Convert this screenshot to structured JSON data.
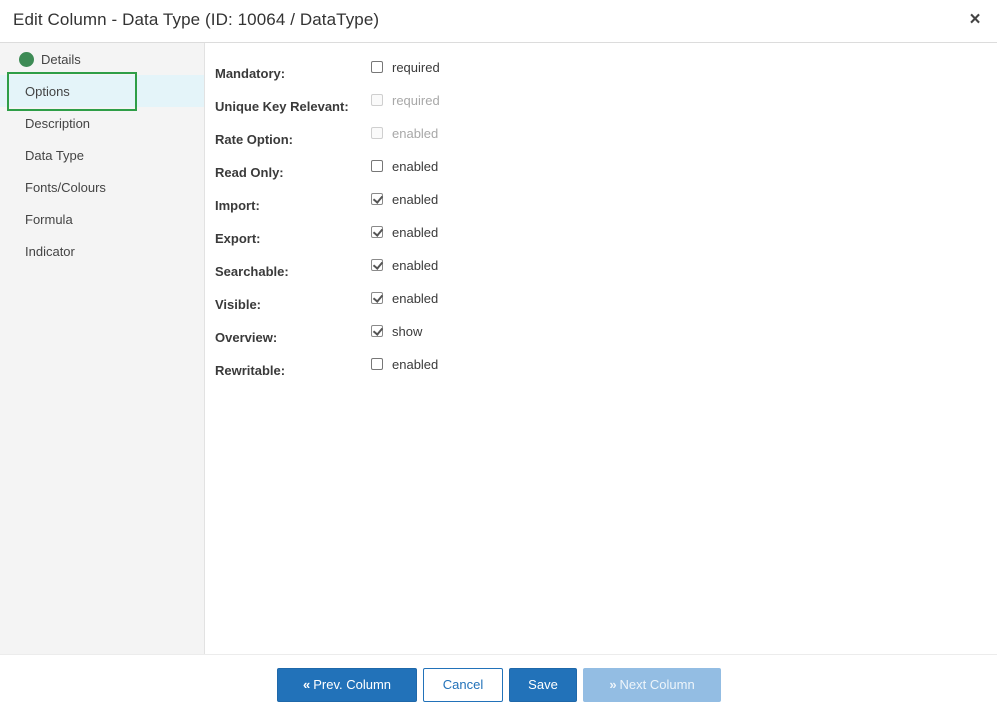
{
  "dialog": {
    "title": "Edit Column - Data Type (ID: 10064 / DataType)",
    "close_icon": "×"
  },
  "sidebar": {
    "items": [
      {
        "label": "Details",
        "status": "complete",
        "status_color": "#3d8b55"
      },
      {
        "label": "Options",
        "active": true
      },
      {
        "label": "Description"
      },
      {
        "label": "Data Type"
      },
      {
        "label": "Fonts/Colours"
      },
      {
        "label": "Formula"
      },
      {
        "label": "Indicator"
      }
    ]
  },
  "options": {
    "rows": [
      {
        "label": "Mandatory:",
        "checkbox_label": "required",
        "checked": false,
        "disabled": false
      },
      {
        "label": "Unique Key Relevant:",
        "checkbox_label": "required",
        "checked": false,
        "disabled": true
      },
      {
        "label": "Rate Option:",
        "checkbox_label": "enabled",
        "checked": false,
        "disabled": true
      },
      {
        "label": "Read Only:",
        "checkbox_label": "enabled",
        "checked": false,
        "disabled": false
      },
      {
        "label": "Import:",
        "checkbox_label": "enabled",
        "checked": true,
        "disabled": false
      },
      {
        "label": "Export:",
        "checkbox_label": "enabled",
        "checked": true,
        "disabled": false
      },
      {
        "label": "Searchable:",
        "checkbox_label": "enabled",
        "checked": true,
        "disabled": false
      },
      {
        "label": "Visible:",
        "checkbox_label": "enabled",
        "checked": true,
        "disabled": false
      },
      {
        "label": "Overview:",
        "checkbox_label": "show",
        "checked": true,
        "disabled": false
      },
      {
        "label": "Rewritable:",
        "checkbox_label": "enabled",
        "checked": false,
        "disabled": false
      }
    ]
  },
  "footer": {
    "prev_icon": "«",
    "prev_label": "Prev. Column",
    "cancel_label": "Cancel",
    "save_label": "Save",
    "next_icon": "»",
    "next_label": "Next Column",
    "next_disabled": true
  },
  "colors": {
    "primary": "#2272b9",
    "primary_disabled": "#93bde3",
    "active_item_bg": "#e4f4f9",
    "focus_ring": "#2e9e47"
  }
}
